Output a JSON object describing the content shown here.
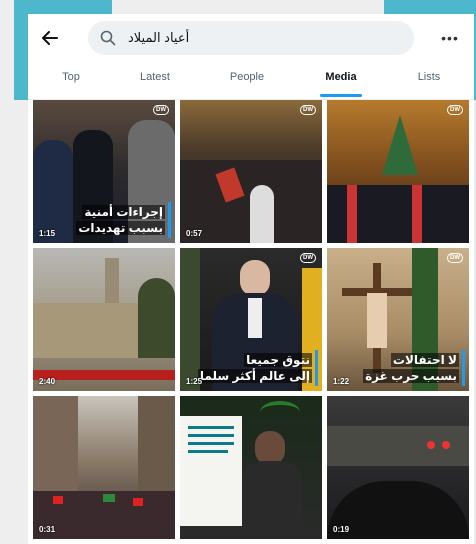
{
  "search": {
    "query": "أعياد الميلاد"
  },
  "tabs": [
    {
      "label": "Top"
    },
    {
      "label": "Latest"
    },
    {
      "label": "People"
    },
    {
      "label": "Media"
    },
    {
      "label": "Lists"
    }
  ],
  "active_tab": "Media",
  "icons": {
    "back": "back-arrow-icon",
    "search": "search-icon",
    "more": "more-options-icon"
  },
  "colors": {
    "accent": "#1d9bf0",
    "deco": "#4db8cc"
  },
  "tiles": [
    {
      "duration": "1:15",
      "caption_line1": "إجراءات أمنية",
      "caption_line2": "بسبب تهديدات",
      "badge": "DW"
    },
    {
      "duration": "0:57",
      "badge": "DW"
    },
    {
      "duration": "",
      "badge": "DW"
    },
    {
      "duration": "2:40",
      "badge": ""
    },
    {
      "duration": "1:25",
      "caption_line1": "نتوق جميعا",
      "caption_line2": "إلى عالم أكثر سلما",
      "badge": "DW"
    },
    {
      "duration": "1:22",
      "caption_line1": "لا احتفالات",
      "caption_line2": "بسبب حرب غزة",
      "badge": "DW"
    },
    {
      "duration": "0:31",
      "badge": ""
    },
    {
      "duration": "",
      "badge": ""
    },
    {
      "duration": "0:19",
      "badge": ""
    }
  ]
}
